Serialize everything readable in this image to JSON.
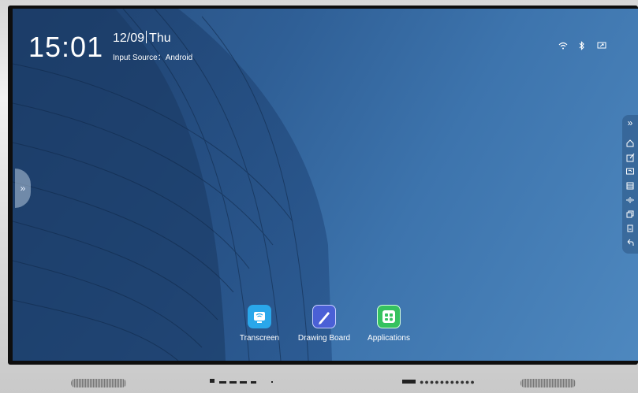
{
  "status_bar": {
    "time": "15:01",
    "date": "12/09",
    "weekday": "Thu",
    "input_source": "Input Source：Android",
    "icons": [
      "wifi-icon",
      "bluetooth-icon",
      "screen-cast-icon"
    ]
  },
  "side_panel": {
    "handle_icon": "double-chevron-right-icon",
    "glyph": "»"
  },
  "toolbar": {
    "collapse_glyph": "»",
    "items": [
      "home-icon",
      "note-icon",
      "whiteboard-icon",
      "menu-icon",
      "signal-icon",
      "windows-icon",
      "screenshot-icon",
      "back-icon"
    ]
  },
  "dock": {
    "apps": [
      {
        "label": "Transcreen",
        "icon": "transcreen-icon",
        "color": "#2aa7ea"
      },
      {
        "label": "Drawing Board",
        "icon": "drawing-board-icon",
        "color": "#4a60d6"
      },
      {
        "label": "Applications",
        "icon": "applications-icon",
        "color": "#35c25f"
      }
    ]
  },
  "colors": {
    "wallpaper": "#2f5f96",
    "bezel": "#0e0e0e",
    "frame": "#d9d9d9"
  }
}
